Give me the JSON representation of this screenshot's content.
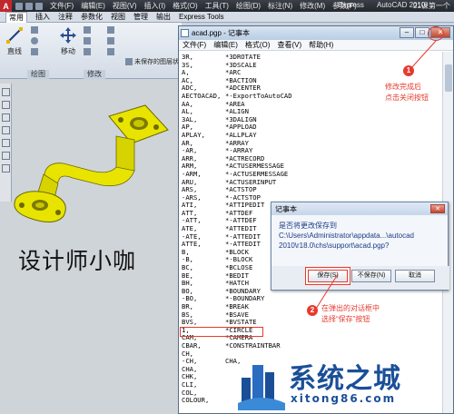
{
  "acad": {
    "logo": "A",
    "menus": [
      "文件(F)",
      "编辑(E)",
      "视图(V)",
      "插入(I)",
      "格式(O)",
      "工具(T)",
      "绘图(D)",
      "标注(N)",
      "修改(M)",
      "参数(P)"
    ],
    "express": "Express",
    "title": "AutoCAD 2010",
    "title_suffix": "21课第一个小"
  },
  "ribbon": {
    "tabs": [
      "常用",
      "插入",
      "注释",
      "参数化",
      "视图",
      "管理",
      "输出",
      "Express Tools"
    ],
    "tools": {
      "line": "直线",
      "move": "移动",
      "unsaved_layer": "未保存的图层状",
      "panel_draw": "绘图",
      "panel_modify": "修改"
    }
  },
  "notepad": {
    "title": "acad.pgp - 记事本",
    "menu": [
      "文件(F)",
      "编辑(E)",
      "格式(O)",
      "查看(V)",
      "帮助(H)"
    ],
    "lines": [
      [
        "3R,",
        "*3DROTATE"
      ],
      [
        "3S,",
        "*3DSCALE"
      ],
      [
        "A,",
        "*ARC"
      ],
      [
        "AC,",
        "*BACTION"
      ],
      [
        "ADC,",
        "*ADCENTER"
      ],
      [
        "AECTOACAD,",
        "*-ExportToAutoCAD"
      ],
      [
        "AA,",
        "*AREA"
      ],
      [
        "AL,",
        "*ALIGN"
      ],
      [
        "3AL,",
        "*3DALIGN"
      ],
      [
        "AP,",
        "*APPLOAD"
      ],
      [
        "APLAY,",
        "*ALLPLAY"
      ],
      [
        "AR,",
        "*ARRAY"
      ],
      [
        "-AR,",
        "*-ARRAY"
      ],
      [
        "ARR,",
        "*ACTRECORD"
      ],
      [
        "ARM,",
        "*ACTUSERMESSAGE"
      ],
      [
        "-ARM,",
        "*-ACTUSERMESSAGE"
      ],
      [
        "ARU,",
        "*ACTUSERINPUT"
      ],
      [
        "ARS,",
        "*ACTSTOP"
      ],
      [
        "-ARS,",
        "*-ACTSTOP"
      ],
      [
        "ATI,",
        "*ATTIPEDIT"
      ],
      [
        "ATT,",
        "*ATTDEF"
      ],
      [
        "-ATT,",
        "*-ATTDEF"
      ],
      [
        "ATE,",
        "*ATTEDIT"
      ],
      [
        "-ATE,",
        "*-ATTEDIT"
      ],
      [
        "ATTE,",
        "*-ATTEDIT"
      ],
      [
        "B,",
        "*BLOCK"
      ],
      [
        "-B,",
        "*-BLOCK"
      ],
      [
        "BC,",
        "*BCLOSE"
      ],
      [
        "BE,",
        "*BEDIT"
      ],
      [
        "BH,",
        "*HATCH"
      ],
      [
        "BO,",
        "*BOUNDARY"
      ],
      [
        "-BO,",
        "*-BOUNDARY"
      ],
      [
        "BR,",
        "*BREAK"
      ],
      [
        "BS,",
        "*BSAVE"
      ],
      [
        "BVS,",
        "*BVSTATE"
      ],
      [
        "1,",
        "*CIRCLE"
      ],
      [
        "CAM,",
        "*CAMERA"
      ],
      [
        "CBAR,",
        "*CONSTRAINTBAR"
      ],
      [
        "CH,",
        ""
      ],
      [
        "-CH,",
        "CHA,"
      ],
      [
        "CHA,",
        ""
      ],
      [
        "CHK,",
        ""
      ],
      [
        "CLI,",
        ""
      ],
      [
        "COL,",
        ""
      ],
      [
        "COLOUR,",
        ""
      ]
    ]
  },
  "dialog": {
    "title": "记事本",
    "message_1": "是否将更改保存到",
    "message_2": "C:\\Users\\Administrator\\appdata...\\autocad",
    "message_3": "2010\\r18.0\\chs\\support\\acad.pgp?",
    "save": "保存(S)",
    "dont_save": "不保存(N)",
    "cancel": "取消"
  },
  "annotations": {
    "step1_marker": "1",
    "step1_text_1": "修改完成后",
    "step1_text_2": "点击关闭按钮",
    "step2_marker": "2",
    "step2_text_1": "在弹出的对话框中",
    "step2_text_2": "选择“保存”按钮"
  },
  "canvas_text": "设计师小咖",
  "brand": {
    "name": "系统之城",
    "url": "xitong86.com"
  },
  "colors": {
    "accent_red": "#e63a2e",
    "pipe_yellow": "#e8e400",
    "brand_blue": "#1a4f98"
  }
}
